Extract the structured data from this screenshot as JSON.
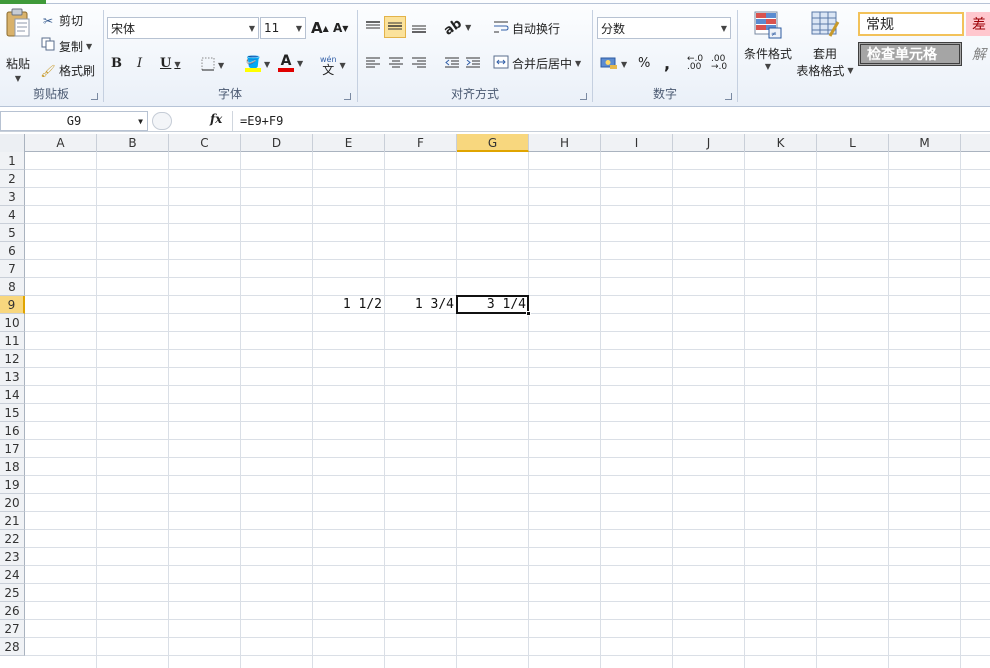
{
  "namebox": {
    "value": "G9"
  },
  "formula_bar": {
    "fx_label": "fx",
    "formula": "=E9+F9"
  },
  "ribbon": {
    "clipboard": {
      "label": "剪贴板",
      "paste": "粘贴",
      "cut": "剪切",
      "copy": "复制",
      "format_painter": "格式刷"
    },
    "font": {
      "label": "字体",
      "font_name": "宋体",
      "font_size": "11",
      "bold": "B",
      "italic": "I",
      "underline": "U",
      "grow": "A",
      "shrink": "A",
      "font_color_glyph": "A",
      "wen": "wén"
    },
    "alignment": {
      "label": "对齐方式",
      "wrap_text": "自动换行",
      "merge_center": "合并后居中"
    },
    "number": {
      "label": "数字",
      "format": "分数",
      "percent": "%",
      "comma": ","
    },
    "styles": {
      "conditional_format": "条件格式",
      "table_format_line1": "套用",
      "table_format_line2": "表格格式",
      "normal": "常规",
      "bad": "差",
      "check_cell": "检查单元格",
      "explain": "解"
    }
  },
  "columns": [
    "A",
    "B",
    "C",
    "D",
    "E",
    "F",
    "G",
    "H",
    "I",
    "J",
    "K",
    "L",
    "M"
  ],
  "selected_column": "G",
  "rows": [
    "1",
    "2",
    "3",
    "4",
    "5",
    "6",
    "7",
    "8",
    "9",
    "10",
    "11",
    "12",
    "13",
    "14",
    "15",
    "16",
    "17",
    "18",
    "19",
    "20",
    "21",
    "22",
    "23",
    "24",
    "25",
    "26",
    "27",
    "28"
  ],
  "selected_row": "9",
  "cells": {
    "E9": "1 1/2",
    "F9": "1 3/4",
    "G9": "3 1/4"
  },
  "colors": {
    "selection_header": "#f8d77e",
    "ribbon_bg": "#eaf0f8",
    "grid_line": "#dadfe6"
  }
}
